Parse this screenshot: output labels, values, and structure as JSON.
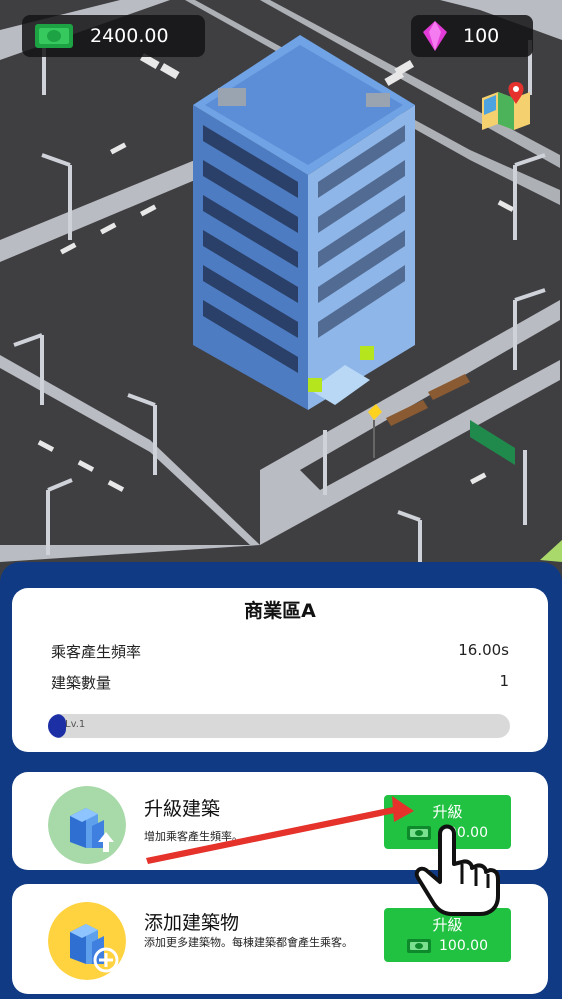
{
  "hud": {
    "cash": "2400.00",
    "gems": "100",
    "cash_icon": "cash-icon",
    "gem_icon": "gem-icon",
    "map_icon": "map-icon"
  },
  "info": {
    "title": "商業區A",
    "stats": [
      {
        "label": "乘客產生頻率",
        "value": "16.00s"
      },
      {
        "label": "建築數量",
        "value": "1"
      }
    ],
    "level_label": "Lv.1",
    "level_progress": 0.03
  },
  "actions": [
    {
      "title": "升級建築",
      "description": "增加乘客產生頻率。",
      "button_label": "升級",
      "cost": "100.00"
    },
    {
      "title": "添加建築物",
      "description": "添加更多建築物。每棟建築都會產生乘客。",
      "button_label": "升級",
      "cost": "100.00"
    }
  ],
  "colors": {
    "panel": "#113a84",
    "button": "#21c241",
    "progress": "#1d2fa5"
  }
}
